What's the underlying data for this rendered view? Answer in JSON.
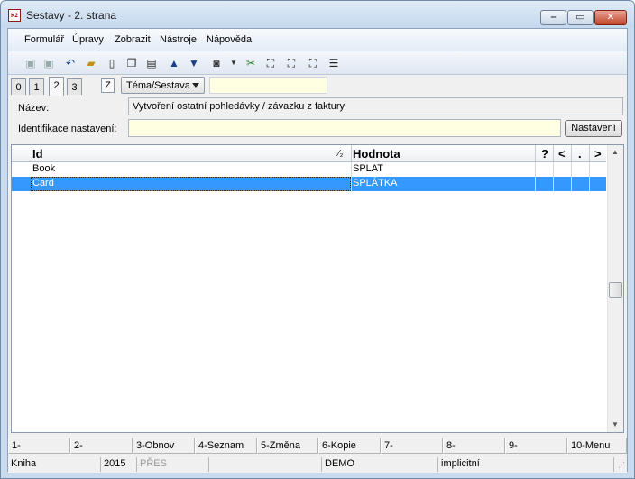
{
  "window": {
    "title": "Sestavy - 2. strana",
    "icon_text": "K2"
  },
  "menu": [
    "Formulář",
    "Úpravy",
    "Zobrazit",
    "Nástroje",
    "Nápověda"
  ],
  "toolbar_icons": [
    "save-icon",
    "save-as-icon",
    "undo-icon",
    "open-folder-icon",
    "new-document-icon",
    "copy-icon",
    "book-icon",
    "arrow-up-icon",
    "arrow-down-icon",
    "camera-icon",
    "dropdown-arrow-icon",
    "filter-icon",
    "binoculars-icon",
    "binoculars-next-icon",
    "binoculars-prev-icon",
    "list-icon"
  ],
  "tabs": [
    "0",
    "1",
    "2",
    "3"
  ],
  "active_tab": "2",
  "zoom_button": "Z",
  "combo": {
    "value": "Téma/Sestava"
  },
  "fields": {
    "name_label": "Název:",
    "name_value": "Vytvoření ostatní pohledávky / závazku z faktury",
    "ident_label": "Identifikace nastavení:",
    "ident_value": "",
    "settings_button": "Nastavení"
  },
  "grid": {
    "columns": {
      "id": "Id",
      "sort_mark": "⁄₂",
      "value": "Hodnota",
      "q": "?",
      "lt": "<",
      "dot": ".",
      "gt": ">"
    },
    "rows": [
      {
        "id": "Book",
        "value": "SPLAT",
        "selected": false
      },
      {
        "id": "Card",
        "value": "SPLÁTKA",
        "selected": true
      }
    ]
  },
  "function_keys": [
    "1-",
    "2-",
    "3-Obnov",
    "4-Seznam",
    "5-Změna",
    "6-Kopie",
    "7-",
    "8-",
    "9-",
    "10-Menu"
  ],
  "status": {
    "book": "Kniha",
    "year": "2015",
    "insert": "PŘES",
    "db": "DEMO",
    "mode": "implicitní"
  }
}
